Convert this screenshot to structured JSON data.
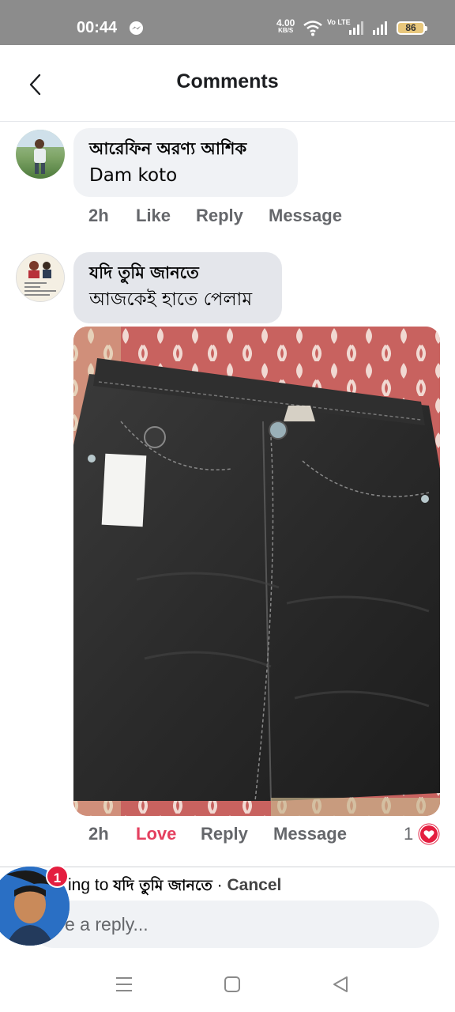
{
  "status_bar": {
    "time": "00:44",
    "speed_value": "4.00",
    "speed_unit": "KB/S",
    "network_label": "Vo LTE",
    "battery": "86",
    "icons": [
      "messenger-icon",
      "wifi-icon",
      "signal-icon",
      "signal-icon",
      "battery-icon"
    ]
  },
  "header": {
    "title": "Comments",
    "back_icon": "chevron-left-icon"
  },
  "comments": [
    {
      "author": "আরেফিন অরণ্য আশিক",
      "text": "Dam koto",
      "time": "2h",
      "like": "Like",
      "reply": "Reply",
      "message": "Message"
    },
    {
      "author": "যদি তুমি জানতে",
      "text": "আজকেই হাতে পেলাম",
      "time": "2h",
      "like": "Love",
      "reply": "Reply",
      "message": "Message",
      "reaction_count": "1",
      "reaction_icon": "heart-icon"
    }
  ],
  "reply_bar": {
    "replying_prefix": "ing to ",
    "replying_name": "যদি তুমি জানতে",
    "separator": " · ",
    "cancel": "Cancel",
    "placeholder": "e a reply...",
    "notification_badge": "1"
  },
  "colors": {
    "love": "#e4405f",
    "badge": "#e41e3f",
    "bubble": "#f0f2f5",
    "secondary_text": "#65676b"
  }
}
